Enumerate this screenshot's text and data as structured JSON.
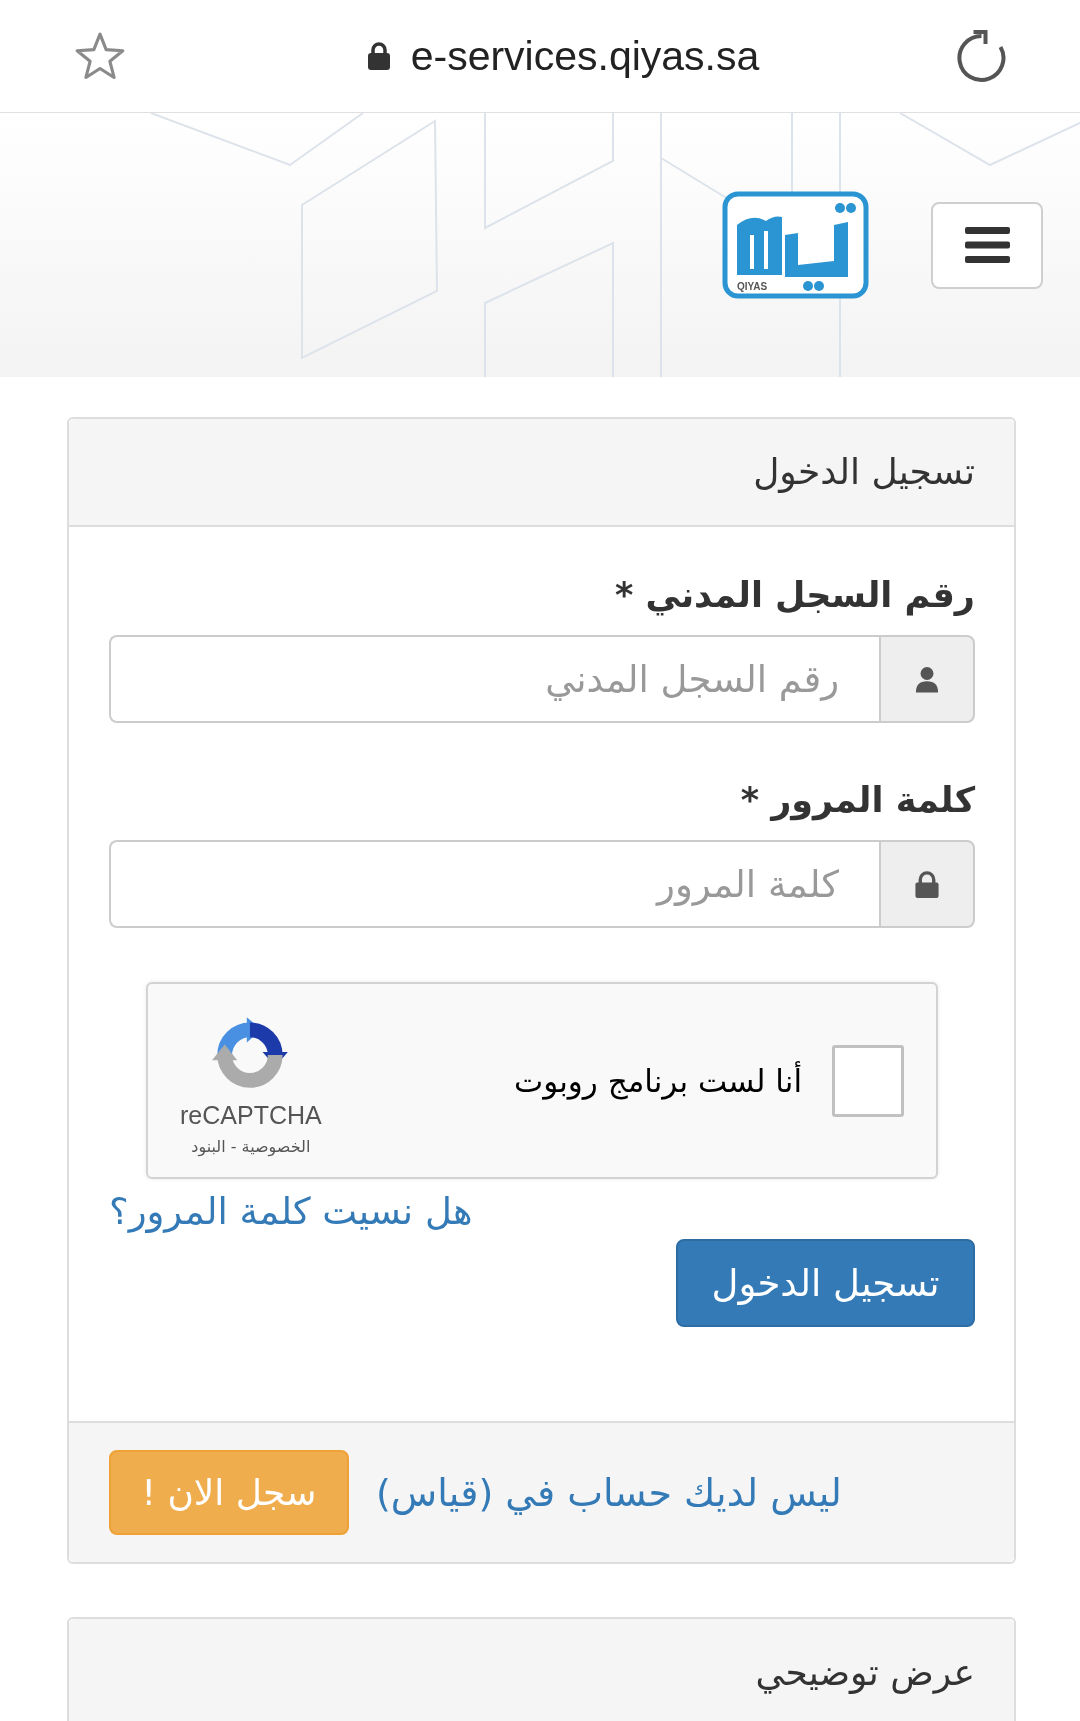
{
  "browser_bar": {
    "url": "e-services.qiyas.sa"
  },
  "header": {
    "logo_caption": "QIYAS"
  },
  "login_panel": {
    "title": "تسجيل الدخول",
    "fields": [
      {
        "kind": "text",
        "label": "رقم السجل المدني *",
        "placeholder": "رقم السجل المدني"
      },
      {
        "kind": "password",
        "label": "كلمة المرور *",
        "placeholder": "كلمة المرور"
      }
    ],
    "captcha": {
      "label": "أنا لست برنامج روبوت",
      "checked": false,
      "brand": "reCAPTCHA",
      "links": "الخصوصية - البنود"
    },
    "forgot_password_link": "هل نسيت كلمة المرور؟",
    "submit_button": "تسجيل الدخول",
    "footer": {
      "text": "ليس لديك حساب في (قياس)",
      "register_button": "سجل الان !"
    }
  },
  "demo_panel": {
    "title": "عرض توضيحي"
  }
}
